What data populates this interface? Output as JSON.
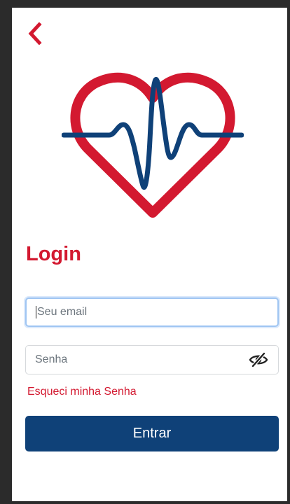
{
  "header": {
    "back_icon": "chevron-left-icon"
  },
  "logo": {
    "icon": "heart-heartbeat-logo",
    "heart_color": "#d31930",
    "line_color": "#0f4178"
  },
  "login": {
    "title": "Login",
    "email_placeholder": "Seu email",
    "password_placeholder": "Senha",
    "password_toggle_icon": "eye-slash-icon",
    "forgot_link": "Esqueci minha Senha",
    "submit_label": "Entrar"
  },
  "colors": {
    "accent_red": "#d31930",
    "primary_blue": "#0f4178"
  }
}
